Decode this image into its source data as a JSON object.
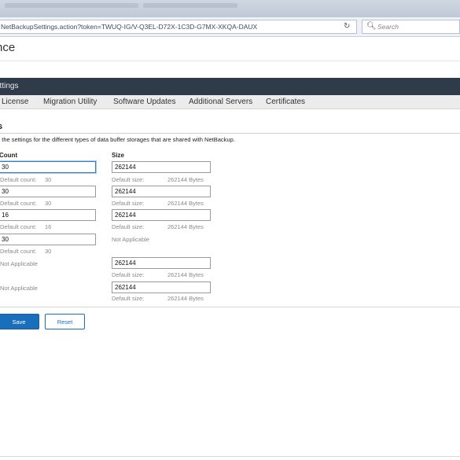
{
  "browser": {
    "url": "NetBackupSettings.action?token=TWUQ-IG/V-Q3EL-D72X-1C3D-G7MX-XKQA-DAUX",
    "search_placeholder": "Search",
    "reload_icon": "reload-icon",
    "search_icon": "search-icon"
  },
  "page": {
    "title": "nce",
    "settings_bar": "ettings"
  },
  "tabs": [
    "License",
    "Migration Utility",
    "Software Updates",
    "Additional Servers",
    "Certificates"
  ],
  "section": {
    "heading": "s",
    "description": "e the settings for the different types of data buffer storages that are shared with NetBackup."
  },
  "columns": {
    "count": "Count",
    "size": "Size"
  },
  "rows": [
    {
      "count_value": "30",
      "count_hint_label": "Default count:",
      "count_hint_value": "30",
      "size_value": "262144",
      "size_hint_label": "Default size:",
      "size_hint_value": "262144 Bytes"
    },
    {
      "count_value": "30",
      "count_hint_label": "Default count:",
      "count_hint_value": "30",
      "size_value": "262144",
      "size_hint_label": "Default size:",
      "size_hint_value": "262144 Bytes"
    },
    {
      "count_value": "16",
      "count_hint_label": "Default count:",
      "count_hint_value": "16",
      "size_value": "262144",
      "size_hint_label": "Default size:",
      "size_hint_value": "262144 Bytes"
    },
    {
      "count_value": "30",
      "count_hint_label": "Default count:",
      "count_hint_value": "30",
      "size_na": "Not Applicable"
    },
    {
      "count_na": "Not Applicable",
      "size_value": "262144",
      "size_hint_label": "Default size:",
      "size_hint_value": "262144 Bytes"
    },
    {
      "count_na": "Not Applicable",
      "size_value": "262144",
      "size_hint_label": "Default size:",
      "size_hint_value": "262144 Bytes"
    }
  ],
  "buttons": {
    "save": "Save",
    "reset": "Reset"
  },
  "colors": {
    "header_bar": "#2f3b48",
    "primary": "#1a6fbd",
    "focus_border": "#3a7fc4",
    "hint_text": "#8a8a8a"
  }
}
